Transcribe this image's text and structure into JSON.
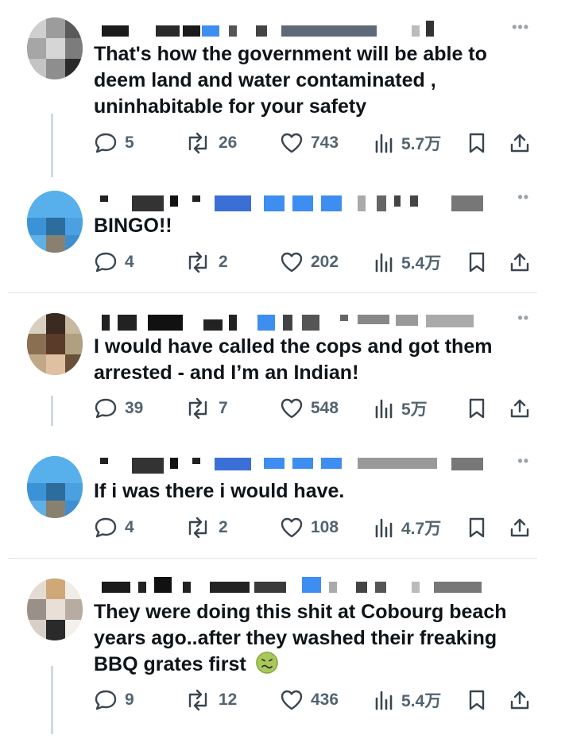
{
  "replies": [
    {
      "text_lines": [
        "That's how the government will be able to",
        "deem land and water contaminated ,",
        "uninhabitable for your safety"
      ],
      "more": "•••",
      "replies_count": "5",
      "reposts_count": "26",
      "likes_count": "743",
      "views_count": "5.7万"
    },
    {
      "text_lines": [
        "BINGO!!"
      ],
      "more": "••",
      "replies_count": "4",
      "reposts_count": "2",
      "likes_count": "202",
      "views_count": "5.4万"
    },
    {
      "text_lines": [
        "I would have called the cops and got them",
        "arrested - and I’m an Indian!"
      ],
      "more": "••",
      "replies_count": "39",
      "reposts_count": "7",
      "likes_count": "548",
      "views_count": "5万"
    },
    {
      "text_lines": [
        "If i was there i would have."
      ],
      "more": "••",
      "replies_count": "4",
      "reposts_count": "2",
      "likes_count": "108",
      "views_count": "4.7万"
    },
    {
      "text_lines": [
        "They were doing this shit at Cobourg beach",
        "years ago..after they washed their freaking",
        "BBQ grates first"
      ],
      "more": "",
      "replies_count": "9",
      "reposts_count": "12",
      "likes_count": "436",
      "views_count": "5.4万",
      "emoji": "nauseated-face"
    }
  ],
  "colors": {
    "text": "#0f1419",
    "meta": "#536471",
    "accent": "#1d9bf0",
    "divider": "#dde3e6"
  }
}
